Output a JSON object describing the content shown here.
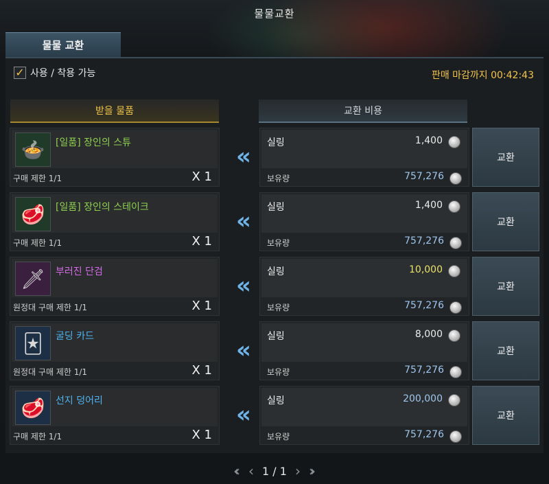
{
  "window": {
    "title": "물물교환"
  },
  "tab": {
    "label": "물물 교환"
  },
  "filter": {
    "label": "사용 / 착용 가능",
    "checked": true
  },
  "deadline": {
    "text": "판매 마감까지 00:42:43"
  },
  "columns": {
    "receive": "받을 물품",
    "cost": "교환 비용"
  },
  "colors": {
    "gold": "#f0c44a",
    "green_name": "#8fd14f",
    "purple_name": "#d46be8",
    "blue_name": "#4fb3f0",
    "blue_value": "#9fc6ee",
    "yellow_price": "#e9e26a"
  },
  "rows": [
    {
      "name": "[일품] 장인의 스튜",
      "name_color": "#8fd14f",
      "icon": "stew-icon",
      "limit": "구매 제한 1/1",
      "qty": "X 1",
      "currency": "실링",
      "price": "1,400",
      "price_color": "#ececec",
      "owned_label": "보유량",
      "owned": "757,276",
      "button": "교환"
    },
    {
      "name": "[일품] 장인의 스테이크",
      "name_color": "#8fd14f",
      "icon": "steak-icon",
      "limit": "구매 제한 1/1",
      "qty": "X 1",
      "currency": "실링",
      "price": "1,400",
      "price_color": "#ececec",
      "owned_label": "보유량",
      "owned": "757,276",
      "button": "교환"
    },
    {
      "name": "부러진 단검",
      "name_color": "#d46be8",
      "icon": "dagger-icon",
      "limit": "원정대 구매 제한 1/1",
      "qty": "X 1",
      "currency": "실링",
      "price": "10,000",
      "price_color": "#e9e26a",
      "owned_label": "보유량",
      "owned": "757,276",
      "button": "교환"
    },
    {
      "name": "굴딩 카드",
      "name_color": "#4fb3f0",
      "icon": "card-icon",
      "limit": "원정대 구매 제한 1/1",
      "qty": "X 1",
      "currency": "실링",
      "price": "8,000",
      "price_color": "#ececec",
      "owned_label": "보유량",
      "owned": "757,276",
      "button": "교환"
    },
    {
      "name": "선지 덩어리",
      "name_color": "#4fb3f0",
      "icon": "meat-icon",
      "limit": "구매 제한 1/1",
      "qty": "X 1",
      "currency": "실링",
      "price": "200,000",
      "price_color": "#9fc6ee",
      "owned_label": "보유량",
      "owned": "757,276",
      "button": "교환"
    }
  ],
  "pagination": {
    "label": "1 / 1"
  }
}
